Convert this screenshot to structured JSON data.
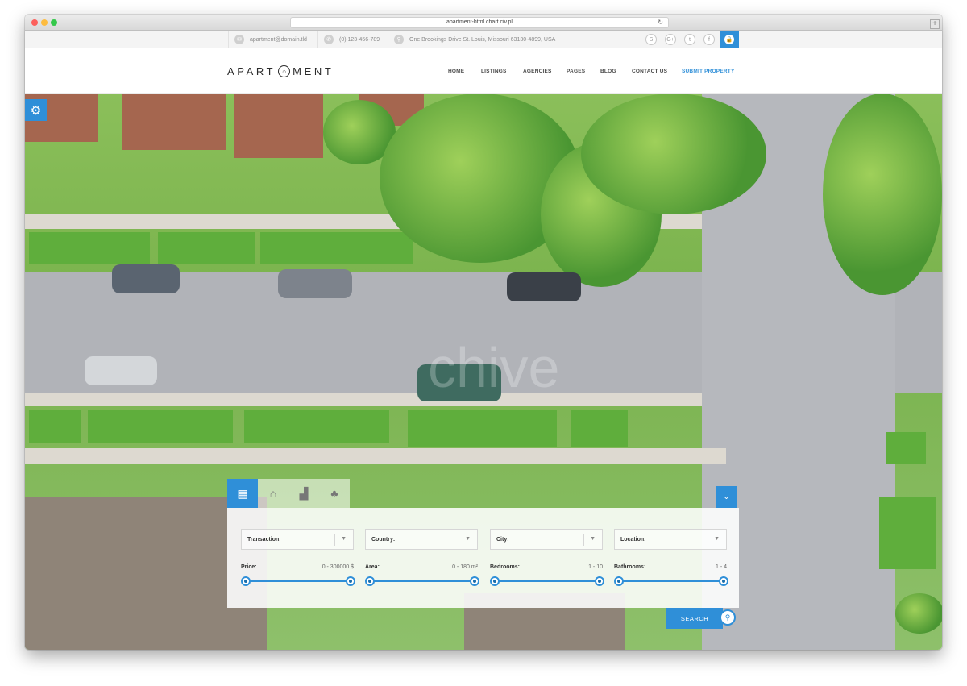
{
  "browser": {
    "url": "apartment-html.chart.civ.pl",
    "reload_icon": "reload-icon",
    "newtab_label": "+"
  },
  "infobar": {
    "email": "apartment@domain.tld",
    "phone": "(0) 123-456-789",
    "address": "One Brookings Drive St. Louis, Missouri 63130-4899, USA",
    "icons": {
      "email": "✉",
      "phone": "✆",
      "address": "⚲",
      "lock": "🔒"
    },
    "socials": [
      "S",
      "G+",
      "t",
      "f"
    ]
  },
  "header": {
    "logo_left": "APART",
    "logo_house": "⌂",
    "logo_right": "MENT",
    "nav": [
      "HOME",
      "LISTINGS",
      "AGENCIES",
      "PAGES",
      "BLOG",
      "CONTACT US",
      "SUBMIT PROPERTY"
    ]
  },
  "hero": {
    "watermark": "chive",
    "gear_icon": "⚙"
  },
  "search": {
    "tabs": [
      "▦",
      "⌂",
      "▟",
      "♣"
    ],
    "collapse_icon": "⌄",
    "selects": [
      "Transaction:",
      "Country:",
      "City:",
      "Location:"
    ],
    "select_arrow": "▼",
    "ranges": [
      {
        "label": "Price:",
        "value": "0 - 300000  $",
        "min_fraction": 0.0,
        "max_fraction": 1.0
      },
      {
        "label": "Area:",
        "value": "0 - 180  m²",
        "min_fraction": 0.0,
        "max_fraction": 1.0
      },
      {
        "label": "Bedrooms:",
        "value": "1 - 10",
        "min_fraction": 0.0,
        "max_fraction": 1.0
      },
      {
        "label": "Bathrooms:",
        "value": "1 - 4",
        "min_fraction": 0.0,
        "max_fraction": 1.0
      }
    ],
    "search_label": "SEARCH",
    "search_icon": "⚲"
  },
  "colors": {
    "accent": "#2f8fd8"
  }
}
